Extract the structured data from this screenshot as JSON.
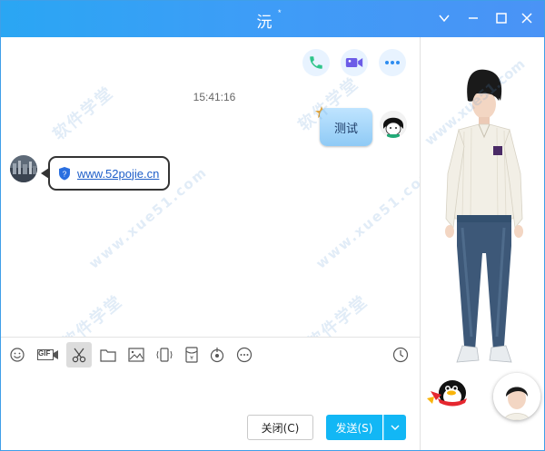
{
  "window": {
    "title": "沅",
    "title_mark": "*"
  },
  "chat": {
    "timestamp": "15:41:16",
    "outgoing_text": "测试",
    "incoming_link": "www.52pojie.cn"
  },
  "toolbar": {
    "items": [
      "emoji-icon",
      "gif-icon",
      "scissors-icon",
      "folder-icon",
      "image-icon",
      "shake-icon",
      "red-packet-icon",
      "music-icon",
      "more-icon",
      "history-icon"
    ],
    "gif_label": "GIF"
  },
  "buttons": {
    "close_label": "关闭(C)",
    "send_label": "发送(S)"
  },
  "watermark": {
    "text_cn": "软件学堂",
    "text_url": "www.xue51.com"
  },
  "colors": {
    "title_bar": "#3d9df7",
    "send_button": "#12b7f5",
    "call_green": "#2fc58a",
    "video_purple": "#6c5ce7",
    "accent_blue": "#1f5fc9"
  }
}
